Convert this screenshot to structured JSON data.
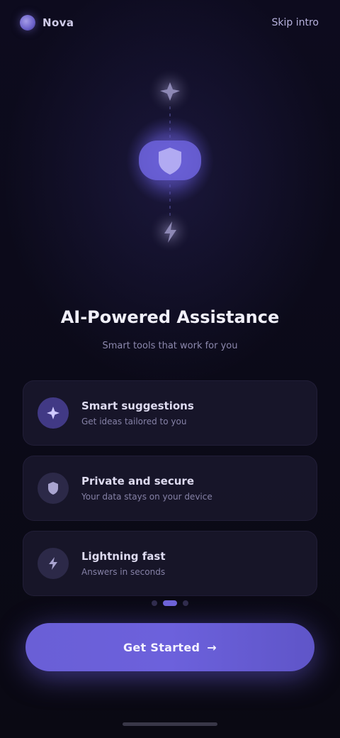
{
  "header": {
    "brand_name": "Nova",
    "skip_label": "Skip intro"
  },
  "hero": {
    "icons": [
      "sparkle-icon",
      "shield-icon",
      "bolt-icon"
    ]
  },
  "intro": {
    "headline": "AI-Powered Assistance",
    "subhead": "Smart tools that work for you"
  },
  "features": [
    {
      "icon": "sparkle-icon",
      "title": "Smart suggestions",
      "description": "Get ideas tailored to you"
    },
    {
      "icon": "shield-icon",
      "title": "Private and secure",
      "description": "Your data stays on your device"
    },
    {
      "icon": "bolt-icon",
      "title": "Lightning fast",
      "description": "Answers in seconds"
    }
  ],
  "pager": {
    "total": 3,
    "active": 1
  },
  "cta": {
    "label": "Get Started"
  },
  "colors": {
    "accent": "#6c61dc",
    "background": "#0b0a16",
    "text_primary": "#f1f0fa",
    "text_secondary": "#8c88ad"
  }
}
